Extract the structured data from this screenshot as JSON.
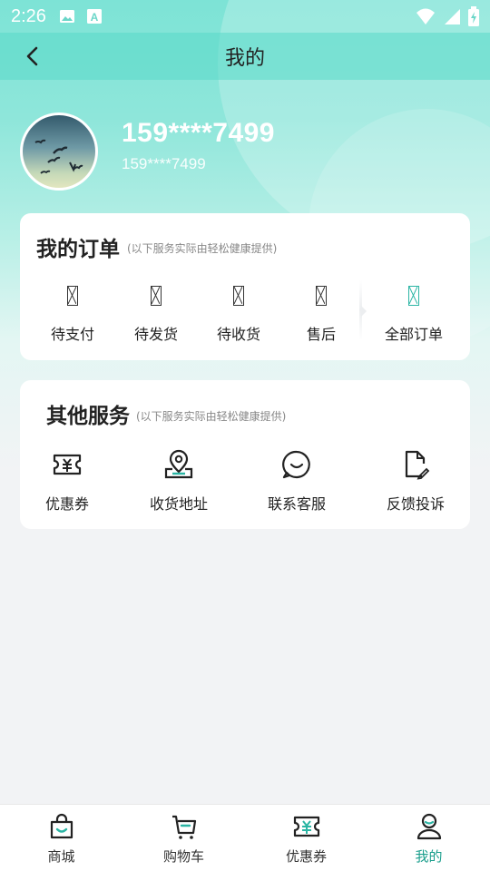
{
  "status_bar": {
    "time": "2:26",
    "left_icons": [
      "image-icon",
      "font-a-icon"
    ],
    "right_icons": [
      "wifi-icon",
      "signal-icon",
      "battery-charging-icon"
    ]
  },
  "nav": {
    "title": "我的",
    "back_icon": "chevron-left-icon"
  },
  "profile": {
    "name": "159****7499",
    "phone": "159****7499"
  },
  "orders": {
    "title": "我的订单",
    "note": "(以下服务实际由轻松健康提供)",
    "items": [
      {
        "label": "待支付",
        "icon": "missing-glyph-icon"
      },
      {
        "label": "待发货",
        "icon": "missing-glyph-icon"
      },
      {
        "label": "待收货",
        "icon": "missing-glyph-icon"
      },
      {
        "label": "售后",
        "icon": "missing-glyph-icon"
      },
      {
        "label": "全部订单",
        "icon": "missing-glyph-icon"
      }
    ]
  },
  "services": {
    "title": "其他服务",
    "note": "(以下服务实际由轻松健康提供)",
    "items": [
      {
        "label": "优惠券",
        "icon": "coupon-icon"
      },
      {
        "label": "收货地址",
        "icon": "location-icon"
      },
      {
        "label": "联系客服",
        "icon": "chat-icon"
      },
      {
        "label": "反馈投诉",
        "icon": "feedback-icon"
      }
    ]
  },
  "tabs": [
    {
      "label": "商城",
      "icon": "shop-bag-icon",
      "active": false
    },
    {
      "label": "购物车",
      "icon": "cart-icon",
      "active": false
    },
    {
      "label": "优惠券",
      "icon": "coupon-icon",
      "active": false
    },
    {
      "label": "我的",
      "icon": "user-icon",
      "active": true
    }
  ],
  "colors": {
    "accent": "#1a9e8c",
    "header_gradient_top": "#7de3d6",
    "background": "#f2f3f5"
  }
}
